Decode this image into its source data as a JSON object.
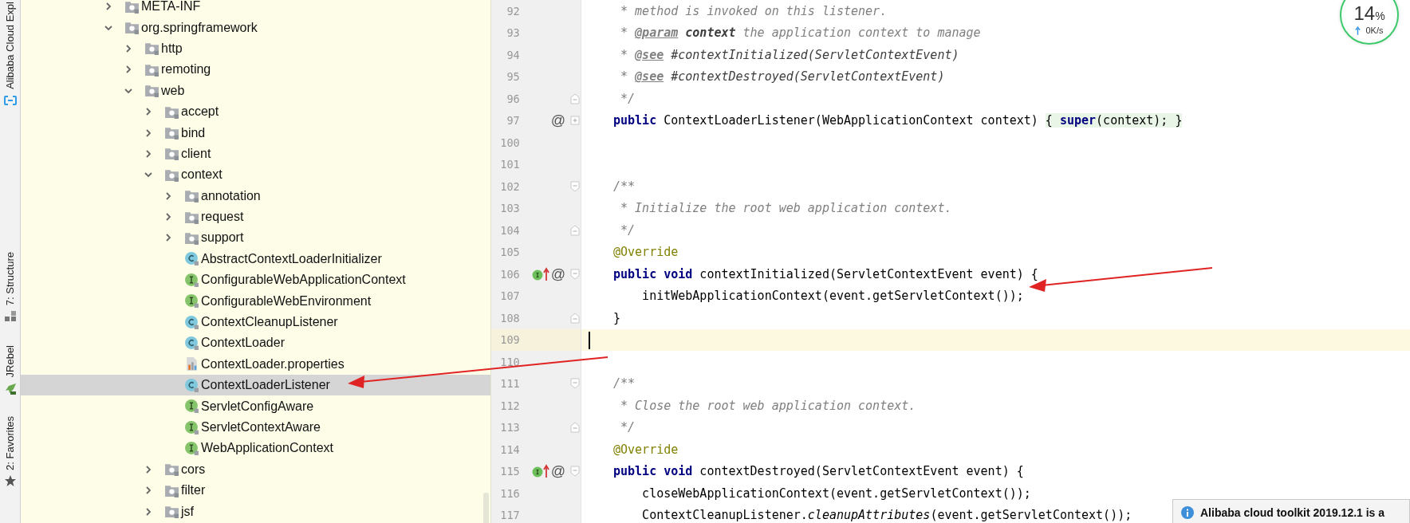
{
  "tool_strip": [
    {
      "label": "Alibaba Cloud Expl",
      "kind": "cloud"
    },
    {
      "label": "7: Structure",
      "kind": "structure"
    },
    {
      "label": "JRebel",
      "kind": "rebel"
    },
    {
      "label": "2: Favorites",
      "kind": "star"
    }
  ],
  "tree": [
    {
      "label": "META-INF",
      "kind": "package",
      "expanded": false,
      "selected": false
    },
    {
      "label": "org.springframework",
      "kind": "package",
      "expanded": true,
      "selected": false,
      "children": [
        {
          "label": "http",
          "kind": "package",
          "expanded": false,
          "selected": false
        },
        {
          "label": "remoting",
          "kind": "package",
          "expanded": false,
          "selected": false
        },
        {
          "label": "web",
          "kind": "package",
          "expanded": true,
          "selected": false,
          "children": [
            {
              "label": "accept",
              "kind": "package",
              "expanded": false,
              "selected": false
            },
            {
              "label": "bind",
              "kind": "package",
              "expanded": false,
              "selected": false
            },
            {
              "label": "client",
              "kind": "package",
              "expanded": false,
              "selected": false
            },
            {
              "label": "context",
              "kind": "package",
              "expanded": true,
              "selected": false,
              "children": [
                {
                  "label": "annotation",
                  "kind": "package",
                  "expanded": false,
                  "selected": false
                },
                {
                  "label": "request",
                  "kind": "package",
                  "expanded": false,
                  "selected": false
                },
                {
                  "label": "support",
                  "kind": "package",
                  "expanded": false,
                  "selected": false
                },
                {
                  "label": "AbstractContextLoaderInitializer",
                  "kind": "class",
                  "selected": false
                },
                {
                  "label": "ConfigurableWebApplicationContext",
                  "kind": "interface",
                  "selected": false
                },
                {
                  "label": "ConfigurableWebEnvironment",
                  "kind": "interface",
                  "selected": false
                },
                {
                  "label": "ContextCleanupListener",
                  "kind": "class",
                  "selected": false
                },
                {
                  "label": "ContextLoader",
                  "kind": "class",
                  "selected": false
                },
                {
                  "label": "ContextLoader.properties",
                  "kind": "properties",
                  "selected": false
                },
                {
                  "label": "ContextLoaderListener",
                  "kind": "class",
                  "selected": true
                },
                {
                  "label": "ServletConfigAware",
                  "kind": "interface",
                  "selected": false
                },
                {
                  "label": "ServletContextAware",
                  "kind": "interface",
                  "selected": false
                },
                {
                  "label": "WebApplicationContext",
                  "kind": "interface",
                  "selected": false
                }
              ]
            },
            {
              "label": "cors",
              "kind": "package",
              "expanded": false,
              "selected": false
            },
            {
              "label": "filter",
              "kind": "package",
              "expanded": false,
              "selected": false
            },
            {
              "label": "jsf",
              "kind": "package",
              "expanded": false,
              "selected": false
            }
          ]
        }
      ]
    }
  ],
  "editor": {
    "lines": [
      {
        "number": "92",
        "current": false,
        "segments": [
          {
            "kind": "comment",
            "text": " * method is invoked on this listener."
          }
        ]
      },
      {
        "number": "93",
        "current": false,
        "segments": [
          {
            "kind": "comment",
            "text": " * "
          },
          {
            "kind": "doctag",
            "text": "@param"
          },
          {
            "kind": "docparam",
            "text": " context"
          },
          {
            "kind": "comment",
            "text": " the application context to manage"
          }
        ]
      },
      {
        "number": "94",
        "current": false,
        "segments": [
          {
            "kind": "comment",
            "text": " * "
          },
          {
            "kind": "doctag",
            "text": "@see"
          },
          {
            "kind": "docref",
            "text": " #contextInitialized(ServletContextEvent)"
          }
        ]
      },
      {
        "number": "95",
        "current": false,
        "segments": [
          {
            "kind": "comment",
            "text": " * "
          },
          {
            "kind": "doctag",
            "text": "@see"
          },
          {
            "kind": "docref",
            "text": " #contextDestroyed(ServletContextEvent)"
          }
        ]
      },
      {
        "number": "96",
        "current": false,
        "fold_end": true,
        "segments": [
          {
            "kind": "comment",
            "text": " */"
          }
        ]
      },
      {
        "number": "97",
        "current": false,
        "mark": "@",
        "collapsed": true,
        "segments": [
          {
            "kind": "keyword",
            "text": "public"
          },
          {
            "kind": "plain",
            "text": " ContextLoaderListener(WebApplicationContext context) "
          },
          {
            "kind": "folded",
            "text": "{ "
          },
          {
            "kind": "folded-keyword",
            "text": "super"
          },
          {
            "kind": "folded",
            "text": "(context); }"
          }
        ]
      },
      {
        "number": "100",
        "current": false
      },
      {
        "number": "101",
        "current": false
      },
      {
        "number": "102",
        "current": false,
        "fold_start": true,
        "segments": [
          {
            "kind": "comment",
            "text": "/**"
          }
        ]
      },
      {
        "number": "103",
        "current": false,
        "segments": [
          {
            "kind": "comment",
            "text": " * Initialize the root web application context."
          }
        ]
      },
      {
        "number": "104",
        "current": false,
        "fold_end": true,
        "segments": [
          {
            "kind": "comment",
            "text": " */"
          }
        ]
      },
      {
        "number": "105",
        "current": false,
        "segments": [
          {
            "kind": "annotation",
            "text": "@Override"
          }
        ]
      },
      {
        "number": "106",
        "current": false,
        "overrides": true,
        "mark": "@",
        "fold_start": true,
        "segments": [
          {
            "kind": "keyword",
            "text": "public void"
          },
          {
            "kind": "plain",
            "text": " contextInitialized(ServletContextEvent event) {"
          }
        ]
      },
      {
        "number": "107",
        "current": false,
        "segments": [
          {
            "kind": "plain",
            "text": "    initWebApplicationContext(event.getServletContext());"
          }
        ]
      },
      {
        "number": "108",
        "current": false,
        "fold_end": true,
        "segments": [
          {
            "kind": "plain",
            "text": "}"
          }
        ]
      },
      {
        "number": "109",
        "current": true
      },
      {
        "number": "110",
        "current": false
      },
      {
        "number": "111",
        "current": false,
        "fold_start": true,
        "segments": [
          {
            "kind": "comment",
            "text": "/**"
          }
        ]
      },
      {
        "number": "112",
        "current": false,
        "segments": [
          {
            "kind": "comment",
            "text": " * Close the root web application context."
          }
        ]
      },
      {
        "number": "113",
        "current": false,
        "fold_end": true,
        "segments": [
          {
            "kind": "comment",
            "text": " */"
          }
        ]
      },
      {
        "number": "114",
        "current": false,
        "segments": [
          {
            "kind": "annotation",
            "text": "@Override"
          }
        ]
      },
      {
        "number": "115",
        "current": false,
        "overrides": true,
        "mark": "@",
        "fold_start": true,
        "segments": [
          {
            "kind": "keyword",
            "text": "public void"
          },
          {
            "kind": "plain",
            "text": " contextDestroyed(ServletContextEvent event) {"
          }
        ]
      },
      {
        "number": "116",
        "current": false,
        "segments": [
          {
            "kind": "plain",
            "text": "    closeWebApplicationContext(event.getServletContext());"
          }
        ]
      },
      {
        "number": "117",
        "current": false,
        "segments": [
          {
            "kind": "plain",
            "text": "    ContextCleanupListener."
          },
          {
            "kind": "static",
            "text": "cleanupAttributes"
          },
          {
            "kind": "plain",
            "text": "(event.getServletContext());"
          }
        ]
      }
    ]
  },
  "monitor": {
    "percent": "14",
    "unit": "%",
    "speed": "0K/s"
  },
  "notification": {
    "title": "Alibaba cloud toolkit 2019.12.1 is a"
  }
}
